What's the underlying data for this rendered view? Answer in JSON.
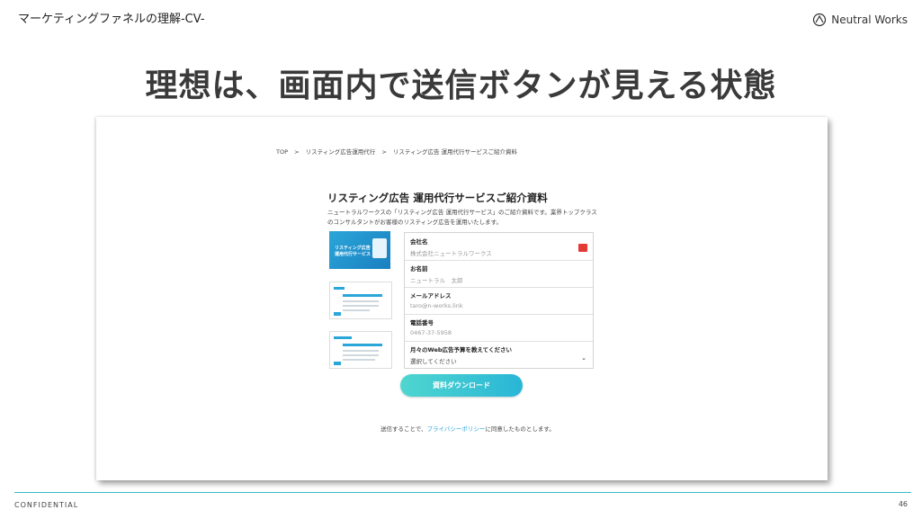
{
  "slide": {
    "header": "マーケティングファネルの理解-CV-",
    "logo_text": "Neutral Works",
    "title": "理想は、画面内で送信ボタンが見える状態",
    "footer_label": "CONFIDENTIAL",
    "page_number": "46"
  },
  "screenshot": {
    "breadcrumb": [
      "TOP",
      "リスティング広告運用代行",
      "リスティング広告 運用代行サービスご紹介資料"
    ],
    "breadcrumb_sep": ">",
    "heading": "リスティング広告 運用代行サービスご紹介資料",
    "description": "ニュートラルワークスの「リスティング広告 運用代行サービス」のご紹介資料です。業界トップクラスのコンサルタントがお客様のリスティング広告を運用いたします。",
    "thumbnail_title": "リスティング広告 運用代行サービス",
    "form": {
      "fields": [
        {
          "label": "会社名",
          "placeholder": "株式会社ニュートラルワークス",
          "required": true
        },
        {
          "label": "お名前",
          "placeholder": "ニュートラル　太郎",
          "required": false
        },
        {
          "label": "メールアドレス",
          "placeholder": "taro@n-works.link",
          "required": false
        },
        {
          "label": "電話番号",
          "placeholder": "0467-37-5958",
          "required": false
        }
      ],
      "select": {
        "label": "月々のWeb広告予算を教えてください",
        "value": "選択してください"
      },
      "submit_label": "資料ダウンロード"
    },
    "consent": {
      "prefix": "送信することで、",
      "link": "プライバシーポリシー",
      "suffix": "に同意したものとします。"
    }
  },
  "colors": {
    "accent": "#2aa6d9",
    "button_start": "#4fd6d0",
    "button_end": "#29b6d6",
    "required": "#e53935",
    "footer_line": "#3db8c8"
  }
}
